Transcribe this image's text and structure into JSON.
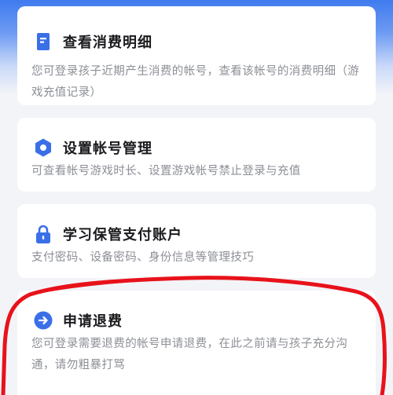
{
  "cards": [
    {
      "icon": "document-list-icon",
      "title": "查看消费明细",
      "desc": "您可登录孩子近期产生消费的帐号，查看该帐号的消费明细（游戏充值记录）"
    },
    {
      "icon": "hexagon-settings-icon",
      "title": "设置帐号管理",
      "desc": "可查看帐号游戏时长、设置游戏帐号禁止登录与充值"
    },
    {
      "icon": "lock-icon",
      "title": "学习保管支付账户",
      "desc": "支付密码、设备密码、身份信息等管理技巧"
    },
    {
      "icon": "arrow-right-circle-icon",
      "title": "申请退费",
      "desc": "您可登录需要退费的帐号申请退费，在此之前请与孩子充分沟通，请勿粗暴打骂"
    }
  ],
  "colors": {
    "accent": "#3a6fe8",
    "annotation": "#e8121a",
    "title": "#1b1b1f",
    "desc": "#8c8f96"
  }
}
